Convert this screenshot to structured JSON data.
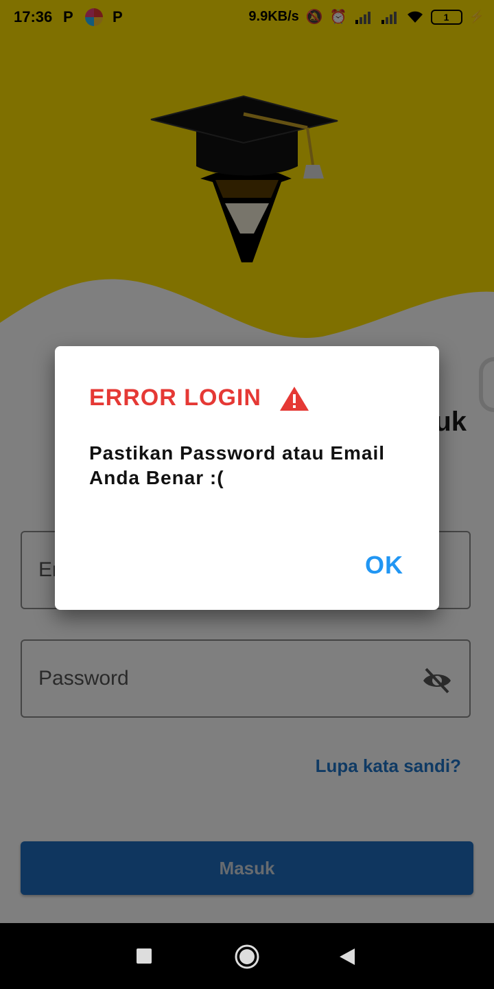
{
  "status_bar": {
    "time": "17:36",
    "network_speed": "9.9KB/s",
    "battery_level": "1",
    "icons": [
      "p-notification-icon",
      "browser-icon",
      "p-notification-icon",
      "mute-icon",
      "alarm-icon",
      "signal-icon",
      "signal-icon",
      "wifi-icon",
      "battery-icon",
      "charging-icon"
    ]
  },
  "colors": {
    "header": "#FFE000",
    "dialog_title": "#E53935",
    "ok_button": "#2196F3",
    "login_button": "#1E6DBF",
    "link": "#1E74C8"
  },
  "page": {
    "title_fragment": "uk",
    "email_placeholder": "Email",
    "password_placeholder": "Password",
    "forgot_password": "Lupa kata sandi?",
    "login_button": "Masuk"
  },
  "dialog": {
    "title": "ERROR LOGIN",
    "message": "Pastikan Password atau Email Anda Benar :(",
    "ok_label": "OK"
  }
}
